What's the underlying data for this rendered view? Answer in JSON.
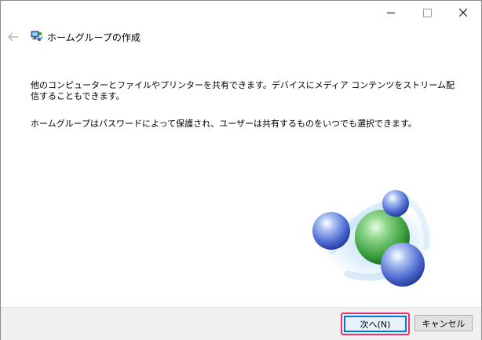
{
  "window": {
    "title": "ホームグループの作成"
  },
  "content": {
    "paragraph1": "他のコンピューターとファイルやプリンターを共有できます。デバイスにメディア コンテンツをストリーム配信することもできます。",
    "paragraph2": "ホームグループはパスワードによって保護され、ユーザーは共有するものをいつでも選択できます。"
  },
  "footer": {
    "next_label": "次へ(N)",
    "cancel_label": "キャンセル"
  },
  "icons": {
    "back": "back-arrow-icon",
    "homegroup": "homegroup-icon",
    "minimize": "minimize-icon",
    "maximize": "maximize-icon",
    "close": "close-icon",
    "illustration": "homegroup-spheres-illustration"
  },
  "colors": {
    "accent": "#0078d7",
    "focus_highlight": "#e8336f",
    "footer_bg": "#f0f0f0"
  }
}
